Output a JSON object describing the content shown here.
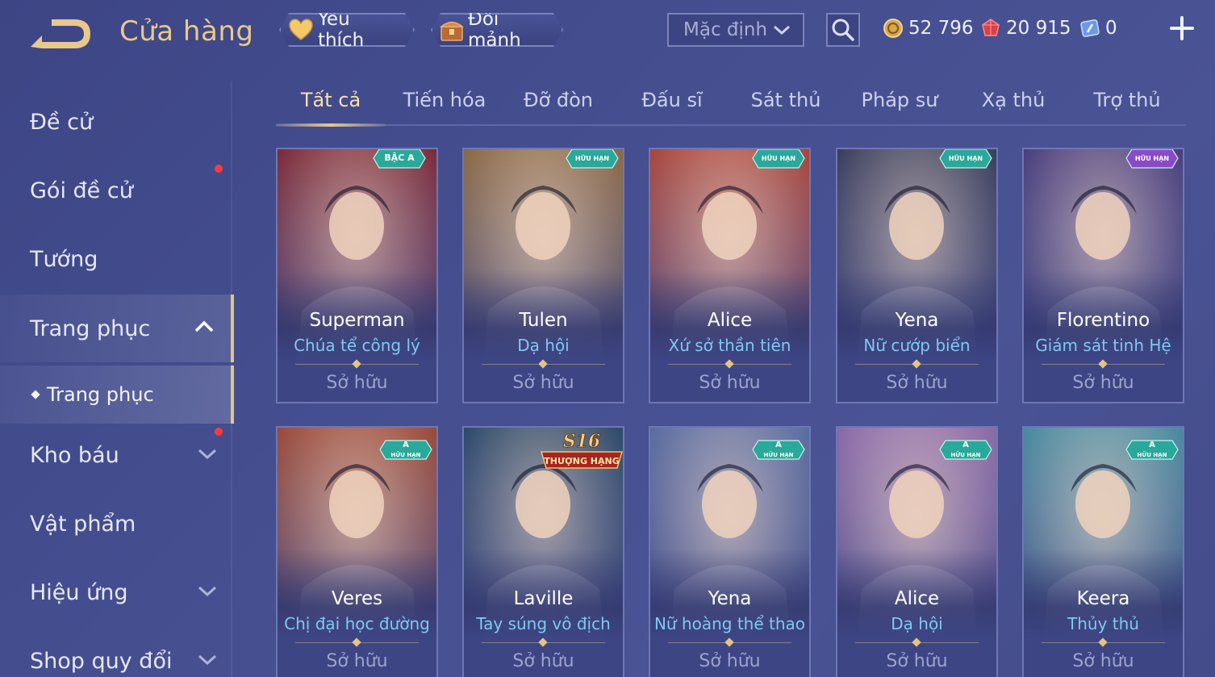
{
  "header": {
    "title": "Cửa hàng",
    "favorites_label": "Yêu thích",
    "shards_label": "Đổi mảnh",
    "sort_value": "Mặc định"
  },
  "currency": {
    "gold": "52 796",
    "ruby": "20 915",
    "voucher": "0"
  },
  "sidebar": {
    "items": [
      {
        "label": "Đề cử"
      },
      {
        "label": "Gói đề cử"
      },
      {
        "label": "Tướng"
      },
      {
        "label": "Trang phục"
      },
      {
        "label": "Kho báu"
      },
      {
        "label": "Vật phẩm"
      },
      {
        "label": "Hiệu ứng"
      },
      {
        "label": "Shop quy đổi"
      }
    ],
    "sub_item": "Trang phục"
  },
  "tabs": [
    "Tất cả",
    "Tiến hóa",
    "Đỡ đòn",
    "Đấu sĩ",
    "Sát thủ",
    "Pháp sư",
    "Xạ thủ",
    "Trợ thủ"
  ],
  "cards": [
    {
      "hero": "Superman",
      "skin": "Chúa tể công lý",
      "status": "Sở hữu",
      "badge": "BẬC A",
      "accent": "#7b2b3a"
    },
    {
      "hero": "Tulen",
      "skin": "Dạ hội",
      "status": "Sở hữu",
      "badge": "HỮU HẠN",
      "accent": "#8a6a48"
    },
    {
      "hero": "Alice",
      "skin": "Xứ sở thần tiên",
      "status": "Sở hữu",
      "badge": "HỮU HẠN",
      "accent": "#a8463f"
    },
    {
      "hero": "Yena",
      "skin": "Nữ cướp biển",
      "status": "Sở hữu",
      "badge": "HỮU HẠN",
      "accent": "#3a3f5e"
    },
    {
      "hero": "Florentino",
      "skin": "Giám sát tinh Hệ",
      "status": "Sở hữu",
      "badge": "HỮU HẠN",
      "accent": "#4a3f7e"
    },
    {
      "hero": "Veres",
      "skin": "Chị đại học đường",
      "status": "Sở hữu",
      "badge": "A HỮU HẠN",
      "accent": "#9a4a3a"
    },
    {
      "hero": "Laville",
      "skin": "Tay súng vô địch",
      "status": "Sở hữu",
      "badge": "S16 THƯỢNG HẠNG",
      "accent": "#2e4a6a"
    },
    {
      "hero": "Yena",
      "skin": "Nữ hoàng thể thao",
      "status": "Sở hữu",
      "badge": "A HỮU HẠN",
      "accent": "#5a6ca0"
    },
    {
      "hero": "Alice",
      "skin": "Dạ hội",
      "status": "Sở hữu",
      "badge": "A HỮU HẠN",
      "accent": "#8a6aa8"
    },
    {
      "hero": "Keera",
      "skin": "Thủy thủ",
      "status": "Sở hữu",
      "badge": "A HỮU HẠN",
      "accent": "#4a8aa0"
    }
  ],
  "colors": {
    "background": "#454f90",
    "title_gold": "#e9c98a",
    "skin_name_blue": "#7fc8f2",
    "notification_dot": "#ff3b3b",
    "badge_teal": "#2aa89a",
    "badge_purple": "#8a4ac8"
  }
}
